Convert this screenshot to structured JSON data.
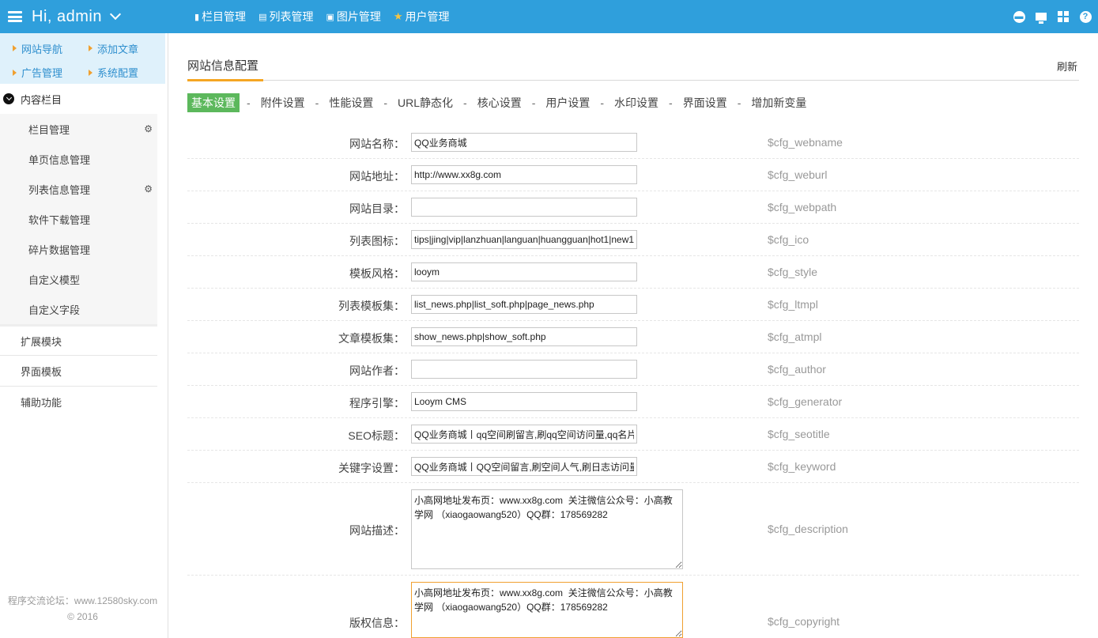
{
  "topbar": {
    "greeting": "Hi, admin",
    "nav": [
      {
        "label": "栏目管理",
        "icon": "column-icon"
      },
      {
        "label": "列表管理",
        "icon": "document-icon"
      },
      {
        "label": "图片管理",
        "icon": "image-icon"
      },
      {
        "label": "用户管理",
        "icon": "star-icon"
      }
    ],
    "right_icons": [
      "message-icon",
      "monitor-icon",
      "grid-icon",
      "help-icon"
    ],
    "help_symbol": "?",
    "bg_color": "#2f9fdc"
  },
  "sidebar": {
    "quick_links": [
      "网站导航",
      "添加文章",
      "广告管理",
      "系统配置"
    ],
    "section": {
      "label": "内容栏目"
    },
    "items": [
      {
        "label": "栏目管理",
        "gear": true
      },
      {
        "label": "单页信息管理",
        "gear": false
      },
      {
        "label": "列表信息管理",
        "gear": true
      },
      {
        "label": "软件下载管理",
        "gear": false
      },
      {
        "label": "碎片数据管理",
        "gear": false
      },
      {
        "label": "自定义模型",
        "gear": false
      },
      {
        "label": "自定义字段",
        "gear": false
      }
    ],
    "groups": [
      "扩展模块",
      "界面模板",
      "辅助功能"
    ],
    "footer_line1": "程序交流论坛：www.12580sky.com",
    "footer_line2": "© 2016"
  },
  "main": {
    "title": "网站信息配置",
    "refresh": "刷新",
    "tabs": [
      "基本设置",
      "附件设置",
      "性能设置",
      "URL静态化",
      "核心设置",
      "用户设置",
      "水印设置",
      "界面设置",
      "增加新变量"
    ],
    "tab_separator": "-",
    "active_tab_color": "#5cb85c",
    "fields": [
      {
        "label": "网站名称：",
        "value": "QQ业务商城",
        "var": "$cfg_webname"
      },
      {
        "label": "网站地址：",
        "value": "http://www.xx8g.com",
        "var": "$cfg_weburl"
      },
      {
        "label": "网站目录：",
        "value": "",
        "var": "$cfg_webpath"
      },
      {
        "label": "列表图标：",
        "value": "tips|jing|vip|lanzhuan|languan|huangguan|hot1|new1",
        "var": "$cfg_ico"
      },
      {
        "label": "模板风格：",
        "value": "looym",
        "var": "$cfg_style"
      },
      {
        "label": "列表模板集：",
        "value": "list_news.php|list_soft.php|page_news.php",
        "var": "$cfg_ltmpl"
      },
      {
        "label": "文章模板集：",
        "value": "show_news.php|show_soft.php",
        "var": "$cfg_atmpl"
      },
      {
        "label": "网站作者：",
        "value": "",
        "var": "$cfg_author"
      },
      {
        "label": "程序引擎：",
        "value": "Looym CMS",
        "var": "$cfg_generator"
      },
      {
        "label": "SEO标题：",
        "value": "QQ业务商城丨qq空间刷留言,刷qq空间访问量,qq名片赞",
        "var": "$cfg_seotitle"
      },
      {
        "label": "关键字设置：",
        "value": "QQ业务商城丨QQ空间留言,刷空间人气,刷日志访问量",
        "var": "$cfg_keyword"
      }
    ],
    "description": {
      "label": "网站描述：",
      "value": "小高网地址发布页：www.xx8g.com  关注微信公众号：小高教学网 （xiaogaowang520）QQ群：178569282",
      "var": "$cfg_description"
    },
    "copyright": {
      "label": "版权信息：",
      "value": "小高网地址发布页：www.xx8g.com  关注微信公众号：小高教学网 （xiaogaowang520）QQ群：178569282",
      "var": "$cfg_copyright"
    },
    "accent_color": "#f5a623"
  }
}
